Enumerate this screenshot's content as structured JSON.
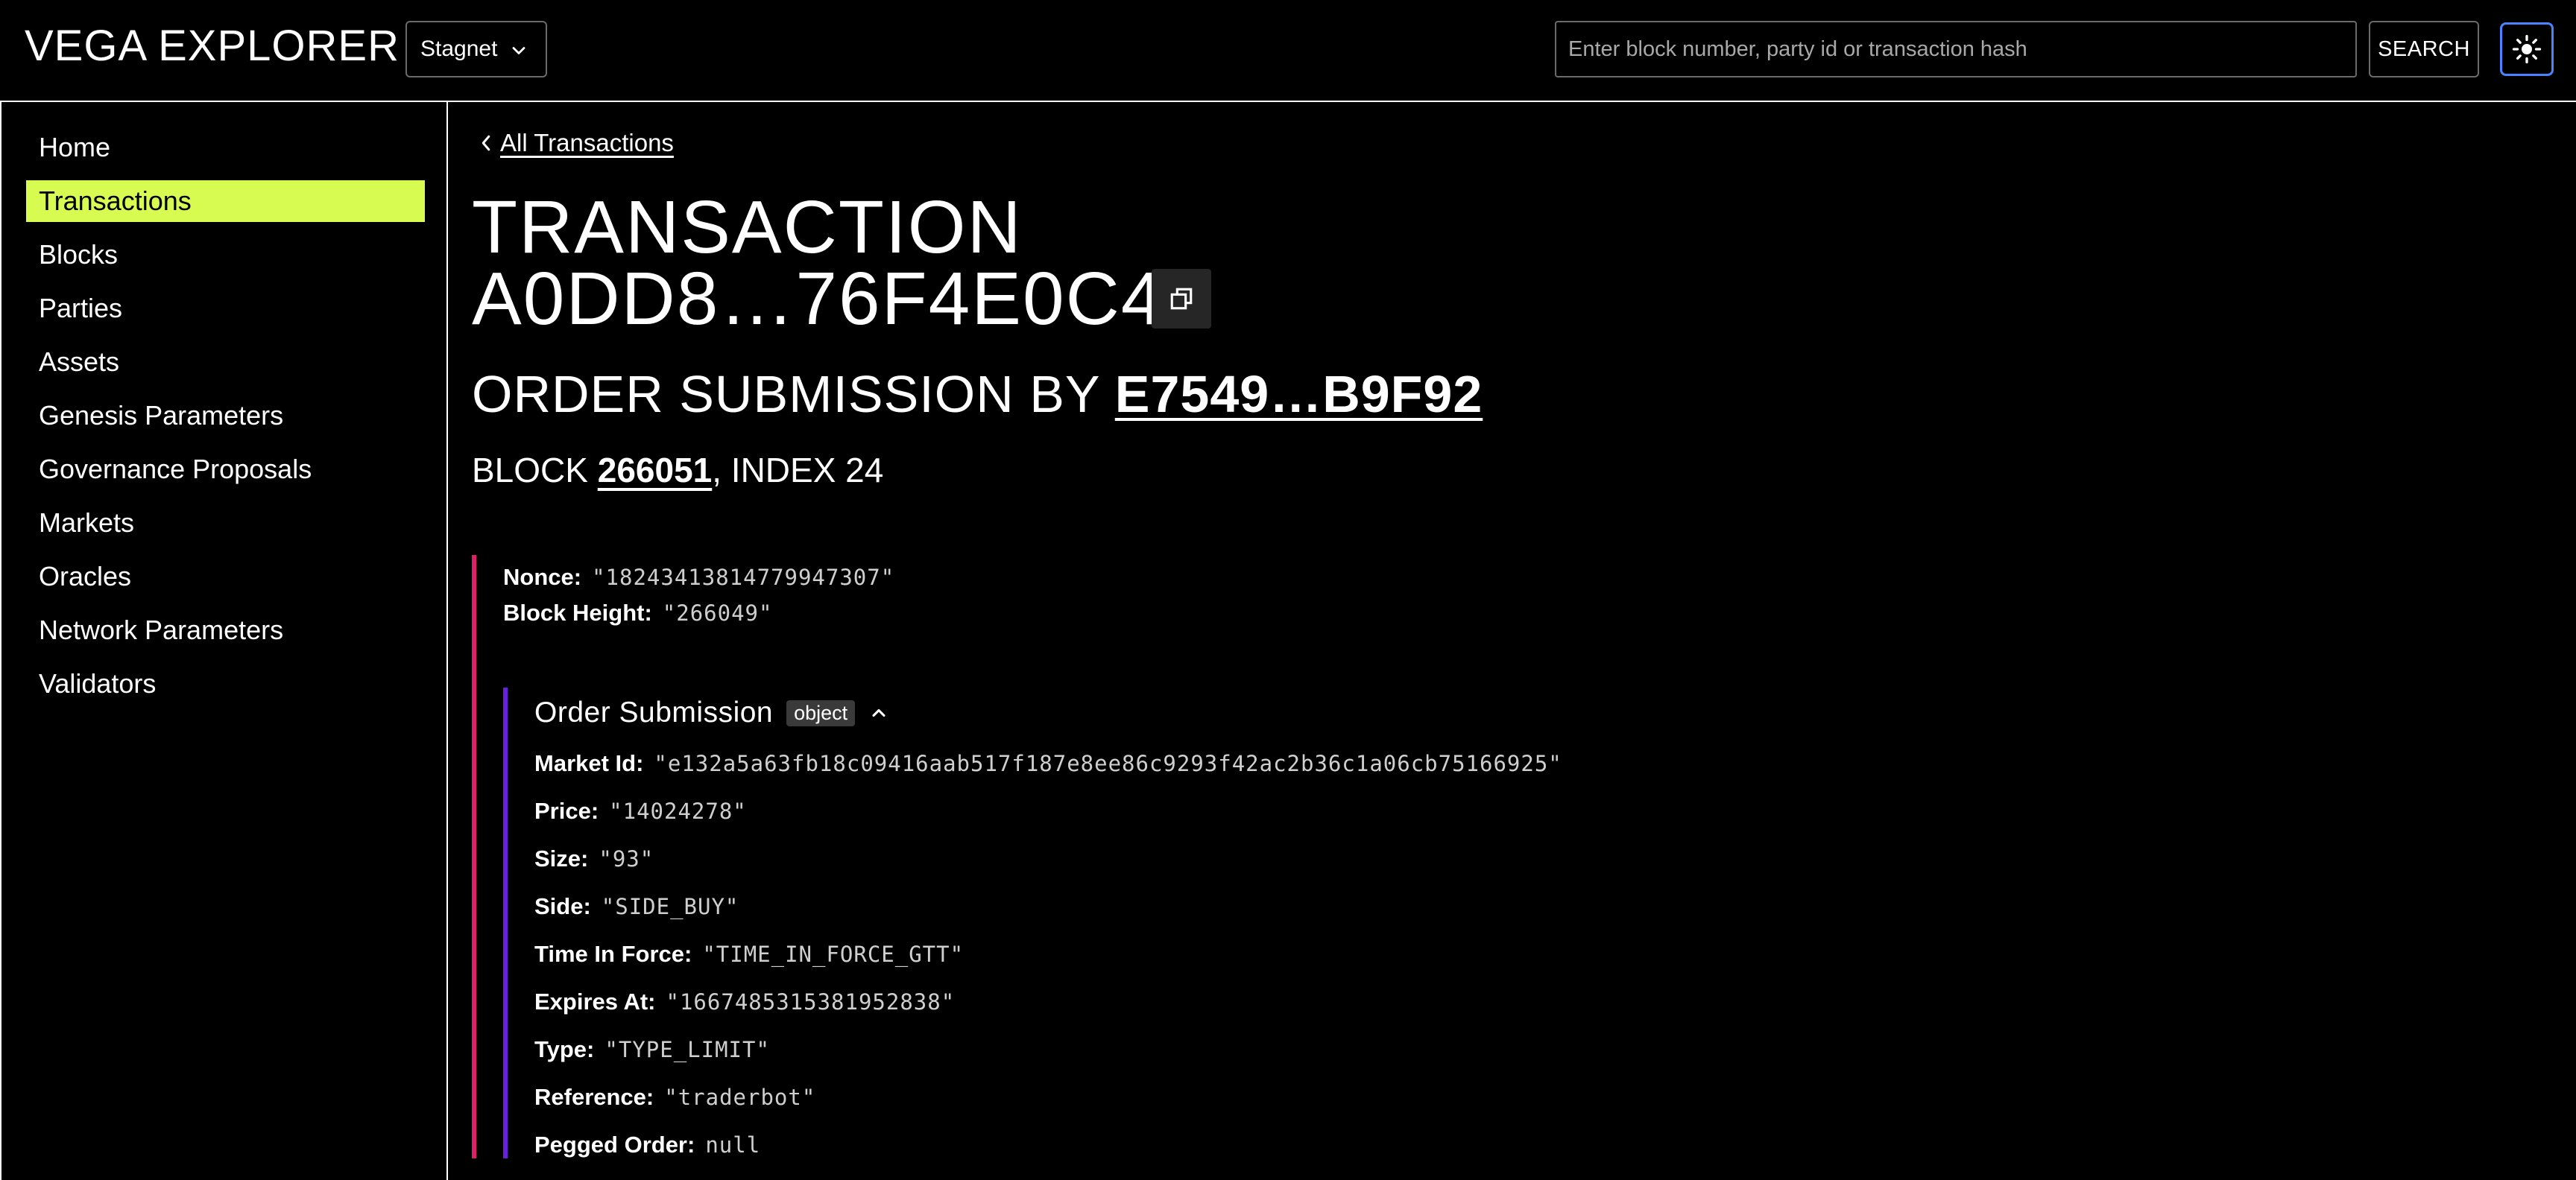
{
  "header": {
    "brand": "VEGA EXPLORER",
    "network": "Stagnet",
    "search_placeholder": "Enter block number, party id or transaction hash",
    "search_label": "SEARCH"
  },
  "sidebar": {
    "items": [
      {
        "label": "Home"
      },
      {
        "label": "Transactions",
        "active": true
      },
      {
        "label": "Blocks"
      },
      {
        "label": "Parties"
      },
      {
        "label": "Assets"
      },
      {
        "label": "Genesis Parameters"
      },
      {
        "label": "Governance Proposals"
      },
      {
        "label": "Markets"
      },
      {
        "label": "Oracles"
      },
      {
        "label": "Network Parameters"
      },
      {
        "label": "Validators"
      }
    ]
  },
  "main": {
    "back_label": "All Transactions",
    "title_line1": "TRANSACTION",
    "title_line2": "A0DD8…76F4E0C43",
    "subtitle_prefix": "ORDER SUBMISSION BY ",
    "party": "E7549…B9F92",
    "block_prefix": "BLOCK ",
    "block": "266051",
    "index_text": ", INDEX 24"
  },
  "tx": {
    "nonce_key": "Nonce:",
    "nonce": "\"18243413814779947307\"",
    "block_height_key": "Block Height:",
    "block_height": "\"266049\"",
    "order_title": "Order Submission",
    "order_badge": "object",
    "fields": [
      {
        "key": "Market Id:",
        "value": "\"e132a5a63fb18c09416aab517f187e8ee86c9293f42ac2b36c1a06cb75166925\""
      },
      {
        "key": "Price:",
        "value": "\"14024278\""
      },
      {
        "key": "Size:",
        "value": "\"93\""
      },
      {
        "key": "Side:",
        "value": "\"SIDE_BUY\""
      },
      {
        "key": "Time In Force:",
        "value": "\"TIME_IN_FORCE_GTT\""
      },
      {
        "key": "Expires At:",
        "value": "\"1667485315381952838\""
      },
      {
        "key": "Type:",
        "value": "\"TYPE_LIMIT\""
      },
      {
        "key": "Reference:",
        "value": "\"traderbot\""
      },
      {
        "key": "Pegged Order:",
        "value": "null"
      }
    ]
  },
  "colors": {
    "accent": "#d7fb50",
    "tree_outer": "#e01f6a",
    "tree_inner": "#6a1fe0",
    "focus": "#4a83ff"
  }
}
